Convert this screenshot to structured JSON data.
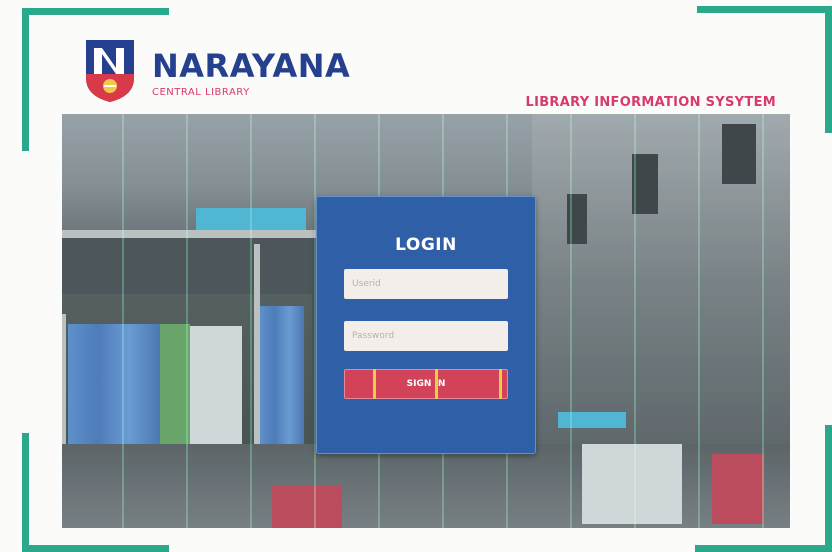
{
  "brand": {
    "name": "NARAYANA",
    "subtitle": "CENTRAL LIBRARY",
    "logo_letter": "N"
  },
  "header": {
    "system_title": "LIBRARY INFORMATION SYSYTEM"
  },
  "login": {
    "title": "LOGIN",
    "username_placeholder": "Userid",
    "password_placeholder": "Password",
    "signin_label": "SIGN IN"
  },
  "colors": {
    "brand_blue": "#24408e",
    "accent_pink": "#d83a6a",
    "card_blue": "#2f5fa6",
    "button_red": "#d2435a",
    "frame_teal": "#2aa88c"
  },
  "icons": {
    "logo": "narayana-shield-logo"
  }
}
